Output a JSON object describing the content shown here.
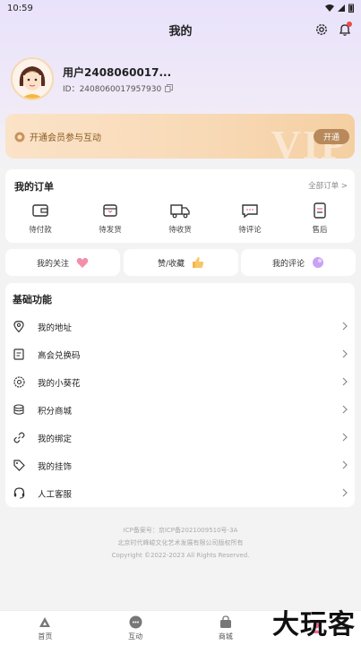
{
  "status_bar": {
    "time": "10:59"
  },
  "header": {
    "title": "我的"
  },
  "profile": {
    "username": "用户2408060017...",
    "id_text": "ID：2408060017957930"
  },
  "vip": {
    "text": "开通会员参与互动",
    "open_label": "开通",
    "watermark": "VIP"
  },
  "orders": {
    "title": "我的订单",
    "all_label": "全部订单 >",
    "items": [
      {
        "label": "待付款",
        "icon": "wallet-icon"
      },
      {
        "label": "待发货",
        "icon": "package-icon"
      },
      {
        "label": "待收货",
        "icon": "truck-icon"
      },
      {
        "label": "待评论",
        "icon": "comment-icon"
      },
      {
        "label": "售后",
        "icon": "document-icon"
      }
    ]
  },
  "quick": [
    {
      "label": "我的关注",
      "icon": "heart-icon",
      "color": "#f06a8c"
    },
    {
      "label": "赞/收藏",
      "icon": "thumbs-up-icon",
      "color": "#f5b54a"
    },
    {
      "label": "我的评论",
      "icon": "bubble-icon",
      "color": "#b88cf0"
    }
  ],
  "functions": {
    "title": "基础功能",
    "items": [
      {
        "label": "我的地址",
        "icon": "location-icon"
      },
      {
        "label": "高会兑换码",
        "icon": "voucher-icon"
      },
      {
        "label": "我的小葵花",
        "icon": "flower-icon"
      },
      {
        "label": "积分商城",
        "icon": "coins-icon"
      },
      {
        "label": "我的绑定",
        "icon": "link-icon"
      },
      {
        "label": "我的挂饰",
        "icon": "tag-icon"
      },
      {
        "label": "人工客服",
        "icon": "headset-icon"
      }
    ]
  },
  "footer": {
    "icp": "ICP备案号：京ICP备2021009510号-3A",
    "company": "北京时代峰峻文化艺术发展有限公司版权所有",
    "copyright": "Copyright ©2022-2023 All Rights Reserved."
  },
  "bottom_nav": [
    {
      "label": "首页",
      "icon": "home-icon"
    },
    {
      "label": "互动",
      "icon": "chat-icon"
    },
    {
      "label": "商城",
      "icon": "bag-icon"
    },
    {
      "label": "",
      "icon": "profile-icon"
    }
  ],
  "watermark_logo": "大玩客"
}
